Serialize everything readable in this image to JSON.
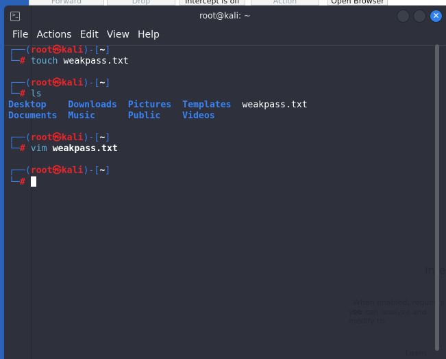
{
  "background_app": {
    "buttons": [
      "Forward",
      "Drop",
      "Intercept is off",
      "Action",
      "Open Browser"
    ],
    "heading_partial": "Inte",
    "text_partial_1": "When enabled, requests se",
    "text_partial_2": "you can analyze and modify th",
    "learn_more_partial": "Learn more"
  },
  "window": {
    "title": "root@kali: ~",
    "close_glyph": "✕"
  },
  "menu": [
    "File",
    "Actions",
    "Edit",
    "View",
    "Help"
  ],
  "prompt": {
    "open": "┌──(",
    "user": "root㉿kali",
    "mid": ")-[",
    "dir": "~",
    "close": "]",
    "second": "└─",
    "hash": "#"
  },
  "commands": [
    {
      "cmd": "touch",
      "arg": "weakpass.txt"
    },
    {
      "cmd": "ls",
      "arg": ""
    },
    {
      "cmd": "vim",
      "arg": "weakpass.txt"
    }
  ],
  "ls_output": {
    "row1": [
      "Desktop",
      "Downloads",
      "Pictures",
      "Templates",
      "weakpass.txt"
    ],
    "row2": [
      "Documents",
      "Music",
      "Public",
      "Videos"
    ]
  },
  "colors": {
    "terminal_bg": "#2e313b",
    "prompt_user": "#e8262a",
    "prompt_frame": "#3b7be8",
    "directory": "#3b82f0",
    "close_button": "#2f80ed"
  }
}
